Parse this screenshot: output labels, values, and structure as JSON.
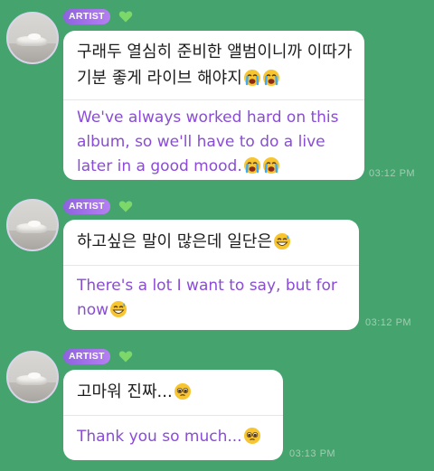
{
  "messages": [
    {
      "badge": "ARTIST",
      "korean": "구래두 열심히 준비한 앨범이니까 이따가 기분 좋게 라이브 해야지",
      "english": "We've always worked hard on this album, so we'll have to do a live later in a good mood.",
      "time": "03:12 PM",
      "emoji": "loudly-crying-face"
    },
    {
      "badge": "ARTIST",
      "korean": "하고싶은 말이 많은데 일단은",
      "english": "There's a lot I want to say, but for now",
      "time": "03:12 PM",
      "emoji": "grinning-sweat-face"
    },
    {
      "badge": "ARTIST",
      "korean": "고마워 진짜...",
      "english": "Thank you so much...",
      "time": "03:13 PM",
      "emoji": "pleading-face"
    }
  ],
  "colors": {
    "background": "#45a46e",
    "badge": "#9a6ae6",
    "translation_text": "#8a4cd6",
    "timestamp": "#a2cdb3",
    "heart": "#7dd86a"
  }
}
